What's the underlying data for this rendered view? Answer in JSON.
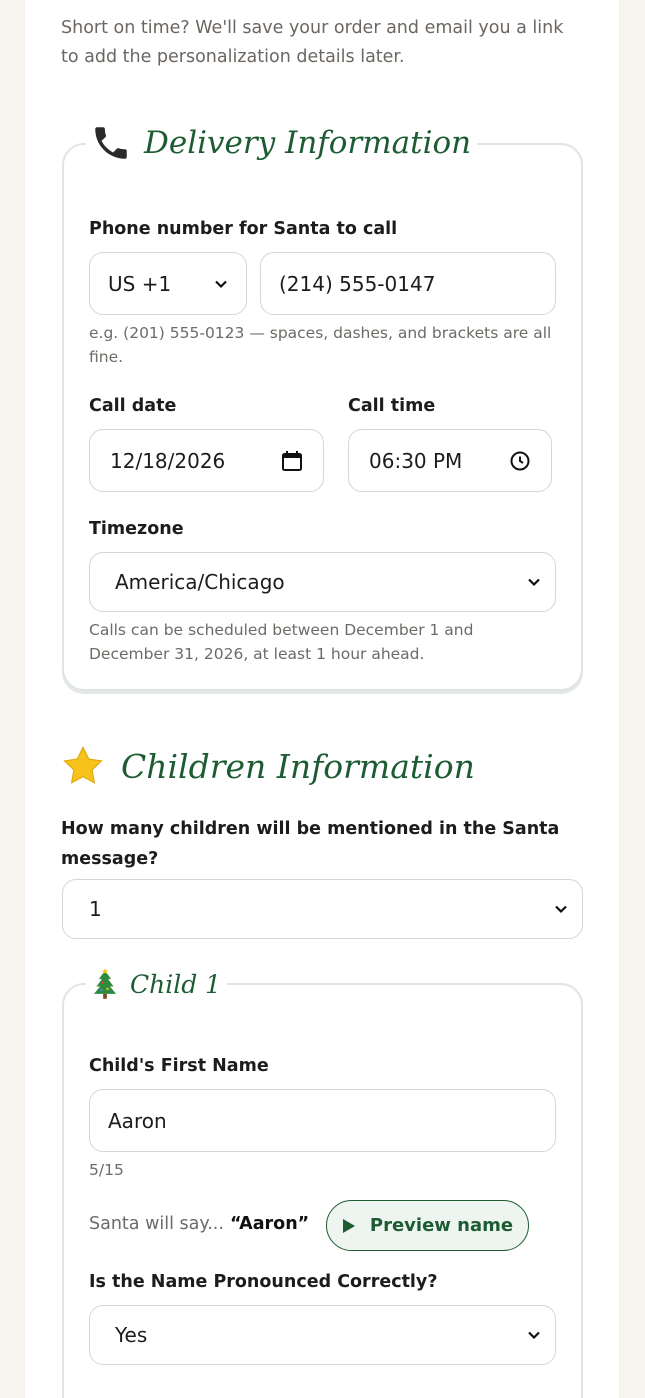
{
  "intro_text": "Short on time? We'll save your order and email you a link to add the personalization details later.",
  "delivery": {
    "title": "Delivery Information",
    "icon": "phone-icon",
    "phone_label": "Phone number for Santa to call",
    "country_code": "US +1",
    "phone_value": "(214) 555-0147",
    "phone_hint": "e.g. (201) 555-0123 — spaces, dashes, and brackets are all fine.",
    "date_label": "Call date",
    "date_value": "12/18/2026",
    "time_label": "Call time",
    "time_value": "06:30 PM",
    "timezone_label": "Timezone",
    "timezone_value": "America/Chicago",
    "schedule_hint": "Calls can be scheduled between December 1 and December 31, 2026, at least 1 hour ahead."
  },
  "children": {
    "title": "Children Information",
    "icon": "star-icon",
    "count_label": "How many children will be mentioned in the Santa message?",
    "count_value": "1",
    "child1": {
      "title": "Child 1",
      "icon": "tree-icon",
      "name_label": "Child's First Name",
      "name_value": "Aaron",
      "char_count": "5/15",
      "santa_says": "Santa will say...",
      "santa_name": "“Aaron”",
      "preview_label": "Preview name",
      "pronounce_label": "Is the Name Pronounced Correctly?",
      "pronounce_value": "Yes"
    }
  },
  "colors": {
    "accent_green": "#1d5c33",
    "border": "#d3d7d5",
    "page_bg": "#f8f5ef"
  }
}
